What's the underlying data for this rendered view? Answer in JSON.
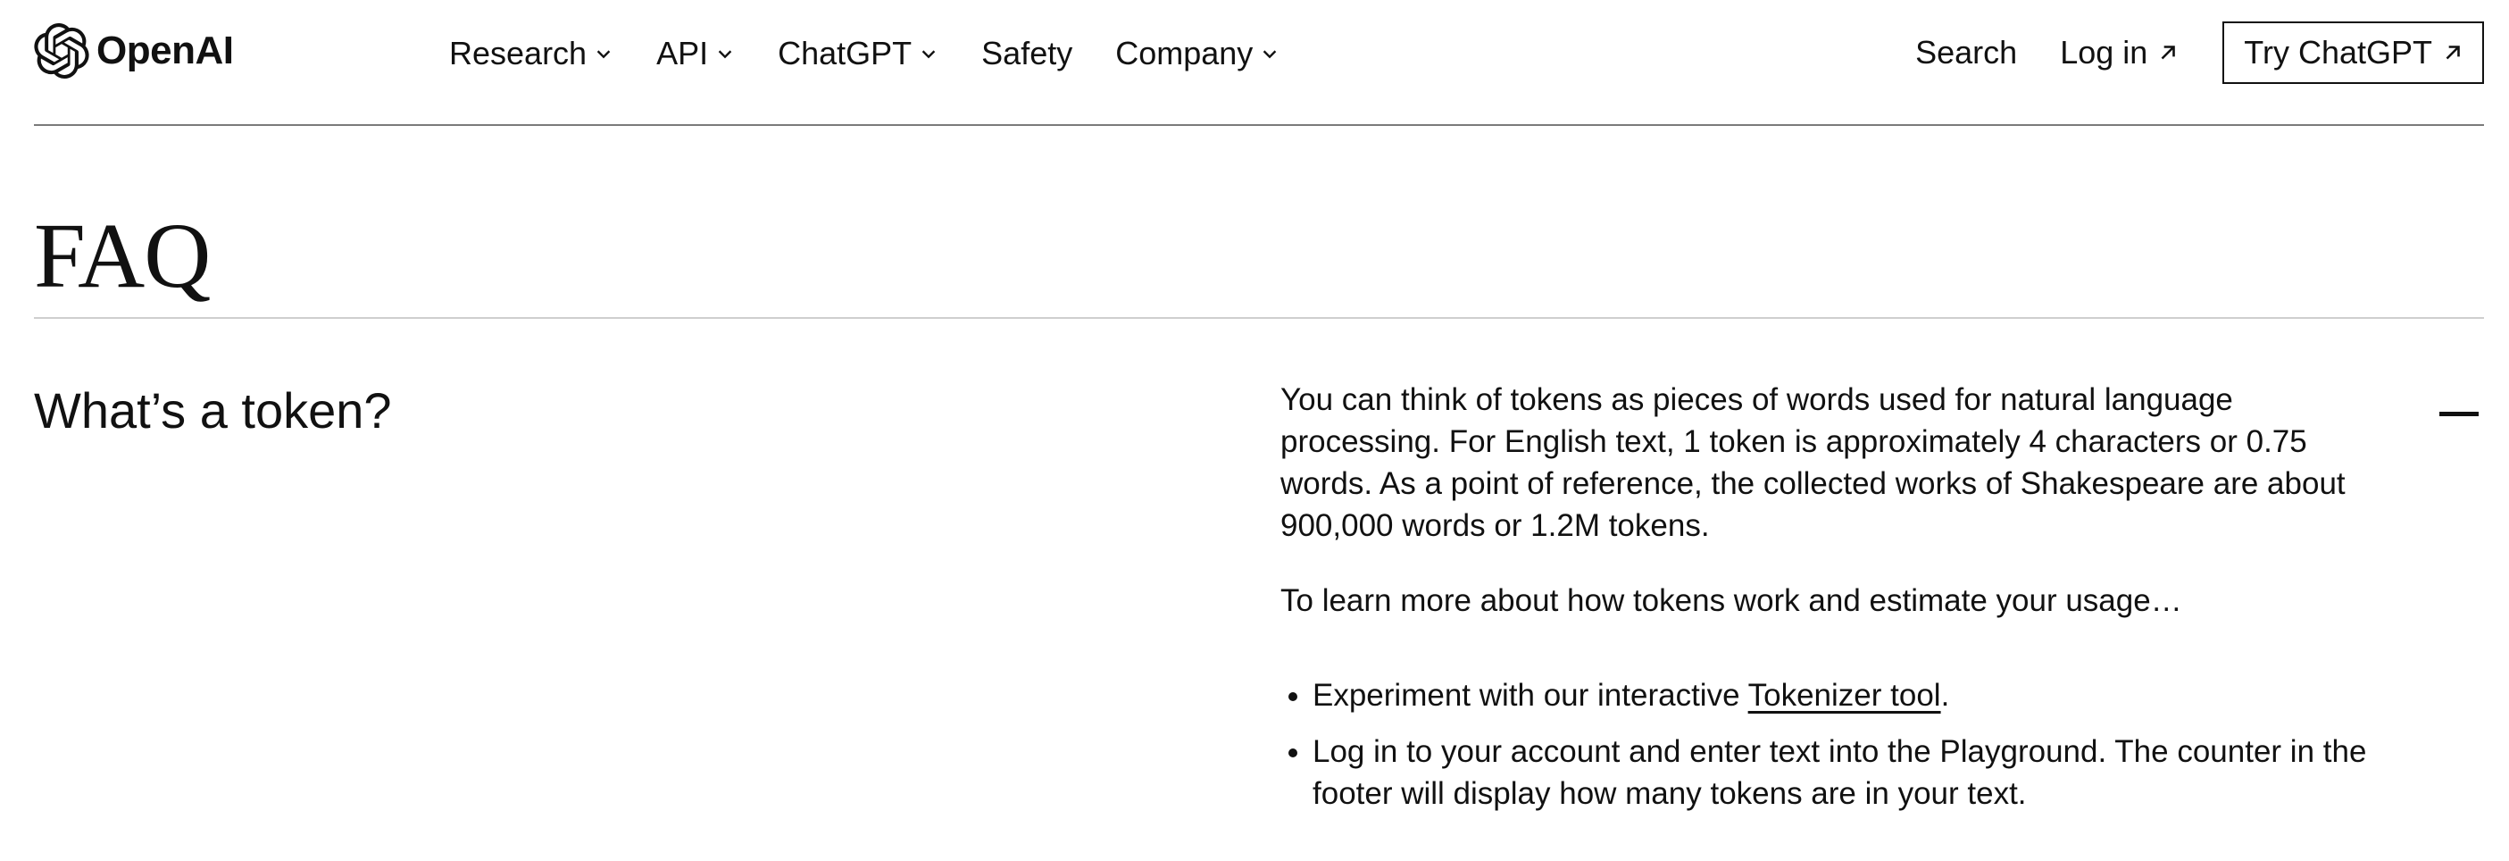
{
  "brand": {
    "logo_text": "OpenAI",
    "logo_icon": "openai-knot-icon"
  },
  "nav": {
    "items": [
      {
        "label": "Research",
        "has_dropdown": true
      },
      {
        "label": "API",
        "has_dropdown": true
      },
      {
        "label": "ChatGPT",
        "has_dropdown": true
      },
      {
        "label": "Safety",
        "has_dropdown": false
      },
      {
        "label": "Company",
        "has_dropdown": true
      }
    ],
    "search_label": "Search",
    "login_label": "Log in",
    "cta_label": "Try ChatGPT"
  },
  "page": {
    "title": "FAQ"
  },
  "faq": {
    "question": "What’s a token?",
    "answer_p1": "You can think of tokens as pieces of words used for natural language processing. For English text, 1 token is approximately 4 characters or 0.75 words. As a point of reference, the collected works of Shakespeare are about 900,000 words or 1.2M tokens.",
    "answer_p2": "To learn more about how tokens work and estimate your usage…",
    "bullet1_prefix": "Experiment with our interactive ",
    "bullet1_link": "Tokenizer tool",
    "bullet1_suffix": ".",
    "bullet2": "Log in to your account and enter text into the Playground. The counter in the footer will display how many tokens are in your text.",
    "expanded": true
  },
  "colors": {
    "text": "#111111",
    "background": "#ffffff",
    "divider_dark": "#7a7a7a",
    "divider_light": "#cfcfcf"
  }
}
